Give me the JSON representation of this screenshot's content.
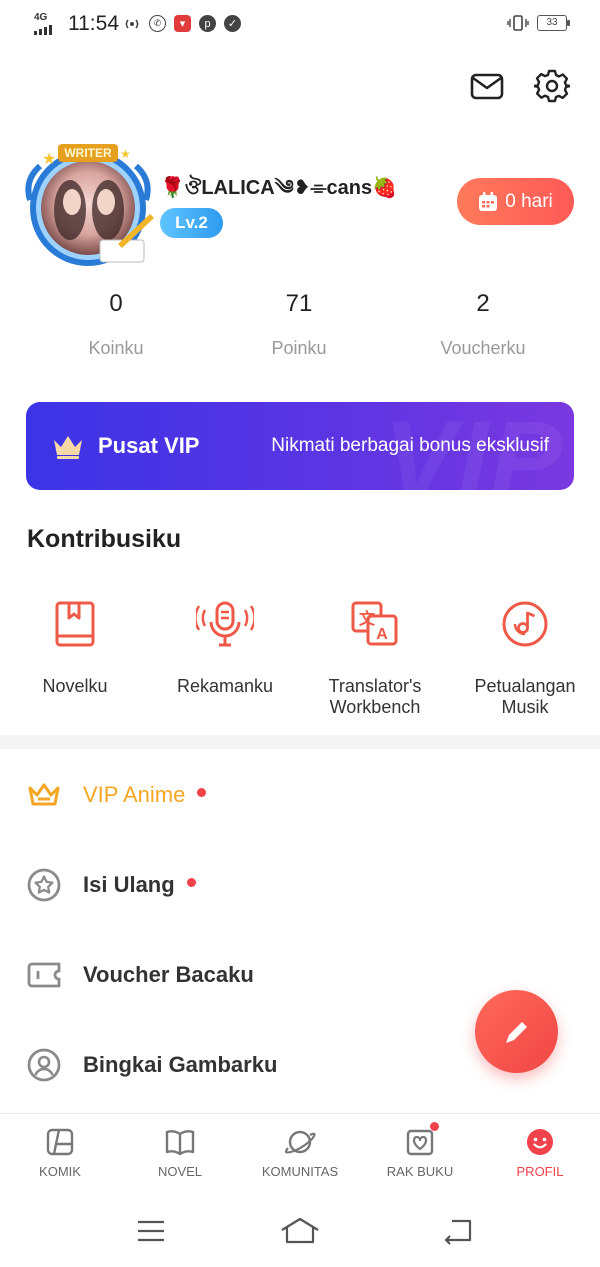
{
  "status_bar": {
    "network": "4G",
    "time": "11:54",
    "battery": "33"
  },
  "header": {
    "mail_icon": "mail-icon",
    "settings_icon": "gear-icon"
  },
  "profile": {
    "avatar_badge": "WRITER",
    "username": "🌹ঔLALICA༄❥⌯cans🍓",
    "level": "Lv.2",
    "checkin_label": "0 hari"
  },
  "stats": [
    {
      "value": "0",
      "label": "Koinku"
    },
    {
      "value": "71",
      "label": "Poinku"
    },
    {
      "value": "2",
      "label": "Voucherku"
    }
  ],
  "vip_banner": {
    "title": "Pusat VIP",
    "subtitle": "Nikmati berbagai bonus eksklusif",
    "watermark": "VIP"
  },
  "contributions": {
    "title": "Kontribusiku",
    "items": [
      {
        "label": "Novelku",
        "icon": "book-icon"
      },
      {
        "label": "Rekamanku",
        "icon": "microphone-icon"
      },
      {
        "label": "Translator's Workbench",
        "icon": "translate-icon"
      },
      {
        "label": "Petualangan Musik",
        "icon": "music-disc-icon"
      }
    ]
  },
  "menu": [
    {
      "label": "VIP Anime",
      "icon": "crown-icon",
      "dot": true,
      "highlight": true
    },
    {
      "label": "Isi Ulang",
      "icon": "star-coin-icon",
      "dot": true
    },
    {
      "label": "Voucher Bacaku",
      "icon": "ticket-icon",
      "dot": false
    },
    {
      "label": "Bingkai Gambarku",
      "icon": "avatar-frame-icon",
      "dot": false
    }
  ],
  "bottom_nav": [
    {
      "label": "KOMIK",
      "icon": "comic-icon"
    },
    {
      "label": "NOVEL",
      "icon": "book-open-icon"
    },
    {
      "label": "KOMUNITAS",
      "icon": "planet-icon"
    },
    {
      "label": "RAK BUKU",
      "icon": "bookshelf-icon",
      "dot": true
    },
    {
      "label": "PROFIL",
      "icon": "smile-icon",
      "active": true
    }
  ],
  "colors": {
    "accent": "#f0424a",
    "vip_gold": "#f5a623",
    "icon_red": "#ee5a47",
    "vip_banner": "#4a35e4",
    "level_badge": "#3aaaf5"
  }
}
